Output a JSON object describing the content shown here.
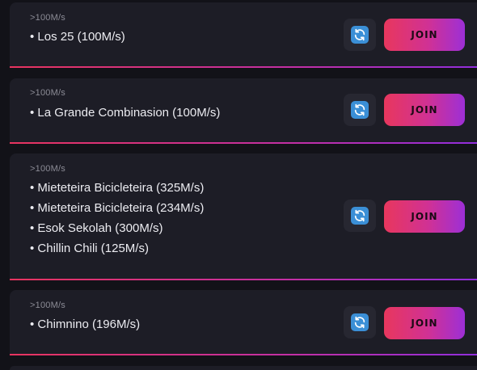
{
  "servers": [
    {
      "tier": ">100M/s",
      "items": [
        "• Los 25 (100M/s)"
      ],
      "join_label": "JOIN",
      "refresh_icon": "refresh-icon"
    },
    {
      "tier": ">100M/s",
      "items": [
        "• La Grande Combinasion (100M/s)"
      ],
      "join_label": "JOIN",
      "refresh_icon": "refresh-icon"
    },
    {
      "tier": ">100M/s",
      "items": [
        "• Mieteteira Bicicleteira (325M/s)",
        "• Mieteteira Bicicleteira (234M/s)",
        "• Esok Sekolah (300M/s)",
        "• Chillin Chili (125M/s)"
      ],
      "join_label": "JOIN",
      "refresh_icon": "refresh-icon"
    },
    {
      "tier": ">100M/s",
      "items": [
        "• Chimnino (196M/s)"
      ],
      "join_label": "JOIN",
      "refresh_icon": "refresh-icon"
    }
  ],
  "colors": {
    "background": "#121218",
    "card": "#1d1d26",
    "accent_start": "#e8345f",
    "accent_end": "#8f2ee0",
    "refresh_icon": "#3b8fd6"
  }
}
